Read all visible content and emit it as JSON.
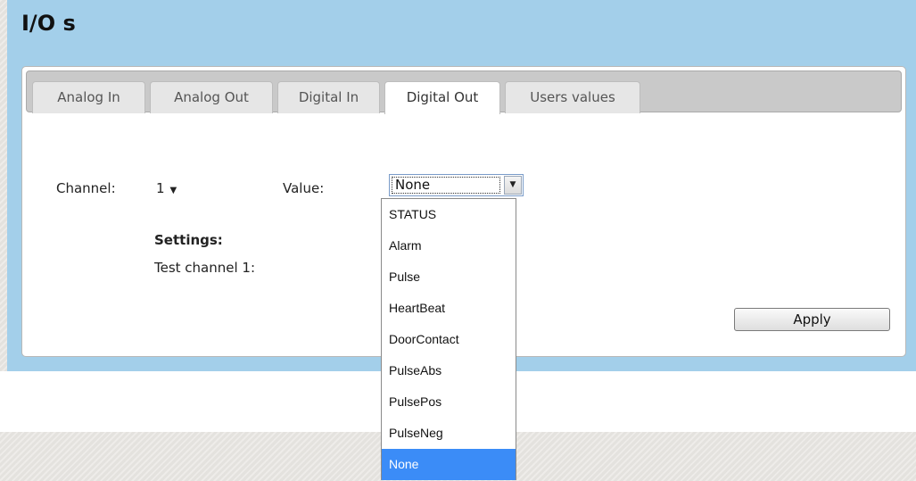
{
  "page": {
    "title": "I/O s"
  },
  "tabs": [
    {
      "label": "Analog In"
    },
    {
      "label": "Analog Out"
    },
    {
      "label": "Digital In"
    },
    {
      "label": "Digital Out",
      "active": true
    },
    {
      "label": "Users values"
    }
  ],
  "form": {
    "channel_label": "Channel:",
    "channel_value": "1",
    "value_label": "Value:",
    "value_current": "None",
    "settings_heading": "Settings:",
    "test_channel_label": "Test channel 1:",
    "apply_label": "Apply"
  },
  "dropdown": {
    "options": [
      "STATUS",
      "Alarm",
      "Pulse",
      "HeartBeat",
      "DoorContact",
      "PulseAbs",
      "PulsePos",
      "PulseNeg",
      "None"
    ],
    "selected": "None"
  },
  "icons": {
    "channel_arrow": "chevron-down-icon",
    "value_arrow": "chevron-down-icon"
  },
  "colors": {
    "header_bg": "#a3cfea",
    "selected_option": "#3b8cf7"
  }
}
